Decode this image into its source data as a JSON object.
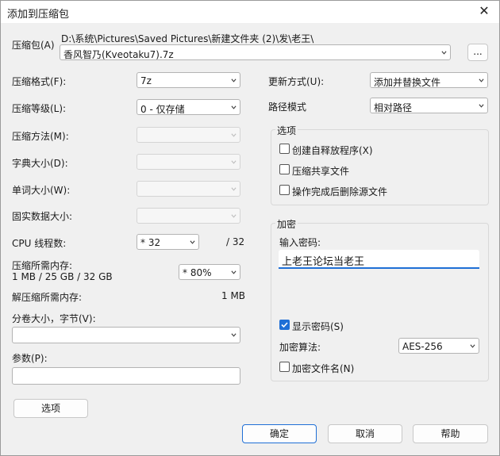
{
  "window": {
    "title": "添加到压缩包"
  },
  "archive": {
    "label": "压缩包(A)",
    "path": "D:\\系统\\Pictures\\Saved Pictures\\新建文件夹 (2)\\发\\老王\\",
    "filename": "香风智乃(Kveotaku7).7z",
    "browse_label": "..."
  },
  "left": {
    "format_label": "压缩格式(F):",
    "format_value": "7z",
    "level_label": "压缩等级(L):",
    "level_value": "0 - 仅存储",
    "method_label": "压缩方法(M):",
    "dict_label": "字典大小(D):",
    "word_label": "单词大小(W):",
    "solid_label": "固实数据大小:",
    "threads_label": "CPU 线程数:",
    "threads_value": "* 32",
    "threads_total": "/ 32",
    "mem_label": "压缩所需内存:",
    "mem_detail": "1 MB / 25 GB / 32 GB",
    "mem_value": "* 80%",
    "decomp_label": "解压缩所需内存:",
    "decomp_value": "1 MB",
    "volume_label": "分卷大小，字节(V):",
    "params_label": "参数(P):",
    "options_button": "选项"
  },
  "right": {
    "update_label": "更新方式(U):",
    "update_value": "添加并替换文件",
    "path_label": "路径模式",
    "path_value": "相对路径",
    "options_group": "选项",
    "opt_sfx": "创建自释放程序(X)",
    "opt_shared": "压缩共享文件",
    "opt_delete": "操作完成后删除源文件",
    "encryption_group": "加密",
    "password_label": "输入密码:",
    "password_value": "上老王论坛当老王",
    "show_password": "显示密码(S)",
    "show_password_checked": true,
    "enc_method_label": "加密算法:",
    "enc_method_value": "AES-256",
    "encrypt_names": "加密文件名(N)"
  },
  "buttons": {
    "ok": "确定",
    "cancel": "取消",
    "help": "帮助"
  },
  "colors": {
    "accent": "#1f6fd6",
    "background": "#f0f0f0"
  }
}
